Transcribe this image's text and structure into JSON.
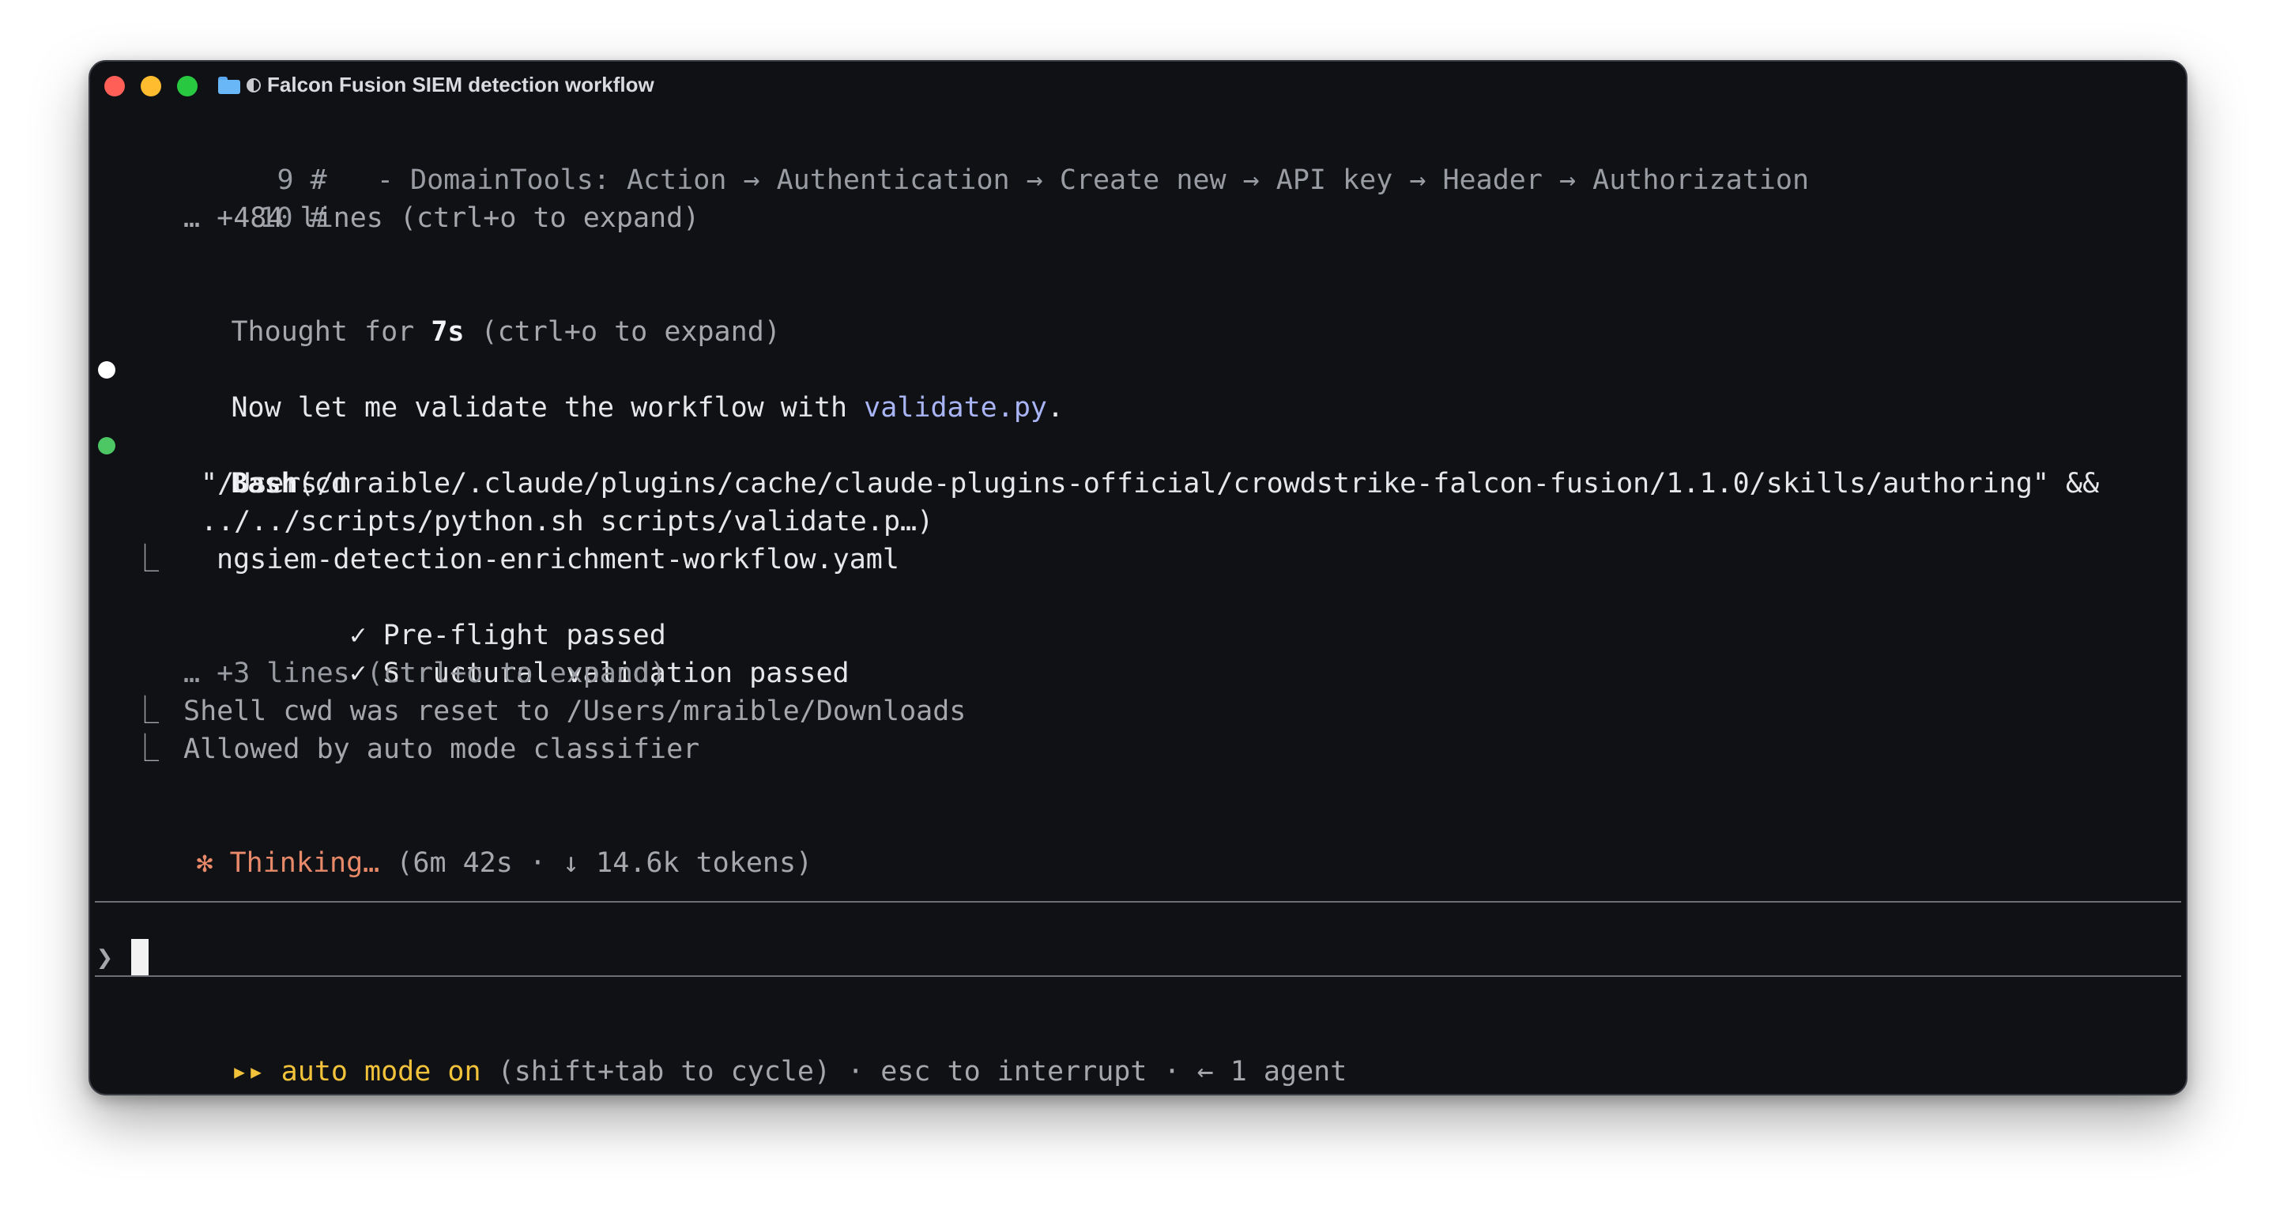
{
  "window": {
    "title": "Falcon Fusion SIEM detection workflow",
    "title_icons": [
      "folder-icon",
      "contrast-icon"
    ]
  },
  "terminal": {
    "code_lines": [
      {
        "num": "9",
        "text": "#   - DomainTools: Action → Authentication → Create new → API key → Header → Authorization"
      },
      {
        "num": "10",
        "text": "#"
      }
    ],
    "collapsed_lines": "… +484 lines (ctrl+o to expand)",
    "thought": {
      "prefix": "Thought for ",
      "duration": "7s",
      "suffix": " (ctrl+o to expand)"
    },
    "message": {
      "prefix": "Now let me validate the workflow with ",
      "file": "validate.py",
      "suffix": "."
    },
    "bash": {
      "tool": "Bash",
      "args_open": "(cd",
      "command_line_1": "\"/Users/mraible/.claude/plugins/cache/claude-plugins-official/crowdstrike-falcon-fusion/1.1.0/skills/authoring\" &&",
      "command_line_2": "../../scripts/python.sh scripts/validate.p…)",
      "output": {
        "filename": "ngsiem-detection-enrichment-workflow.yaml",
        "checks": [
          {
            "mark": "✓",
            "label": "Pre-flight passed"
          },
          {
            "mark": "✓",
            "label": "Structural validation passed"
          }
        ],
        "more": "… +3 lines (ctrl+o to expand)",
        "notes": [
          "Shell cwd was reset to /Users/mraible/Downloads",
          "Allowed by auto mode classifier"
        ]
      }
    },
    "status": {
      "spinner": "✻",
      "label": "Thinking…",
      "detail": " (6m 42s · ↓ 14.6k tokens)"
    },
    "prompt_symbol": "❯",
    "footer": {
      "arrows": "▸▸",
      "mode": "auto mode on",
      "hints": " (shift+tab to cycle) · esc to interrupt · ← 1 agent"
    }
  },
  "colors": {
    "background": "#0f1115",
    "accent_blue": "#a9b4f5",
    "thinking_orange": "#e8896a",
    "auto_mode_yellow": "#f2c23a",
    "success_green": "#4cc764"
  }
}
